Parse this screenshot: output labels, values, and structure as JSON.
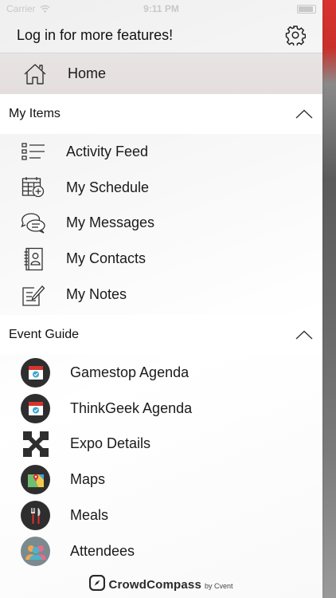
{
  "status_bar": {
    "carrier": "Carrier",
    "time": "9:11 PM"
  },
  "header": {
    "login_text": "Log in for more features!"
  },
  "home": {
    "label": "Home"
  },
  "my_items": {
    "title": "My Items",
    "items": [
      {
        "label": "Activity Feed",
        "icon": "list-icon"
      },
      {
        "label": "My Schedule",
        "icon": "calendar-add-icon"
      },
      {
        "label": "My Messages",
        "icon": "chat-bubbles-icon"
      },
      {
        "label": "My Contacts",
        "icon": "contact-book-icon"
      },
      {
        "label": "My Notes",
        "icon": "note-pencil-icon"
      }
    ]
  },
  "event_guide": {
    "title": "Event Guide",
    "items": [
      {
        "label": "Gamestop Agenda",
        "icon": "agenda-calendar-icon"
      },
      {
        "label": "ThinkGeek Agenda",
        "icon": "agenda-calendar-icon"
      },
      {
        "label": "Expo Details",
        "icon": "expo-icon"
      },
      {
        "label": "Maps",
        "icon": "map-icon"
      },
      {
        "label": "Meals",
        "icon": "fork-knife-icon"
      },
      {
        "label": "Attendees",
        "icon": "people-icon"
      }
    ]
  },
  "footer": {
    "brand": "CrowdCompass",
    "by": "by Cvent"
  },
  "colors": {
    "accent_red": "#d8332e",
    "calendar_teal": "#3aa7c9",
    "dark_icon": "#2e2e2e"
  }
}
